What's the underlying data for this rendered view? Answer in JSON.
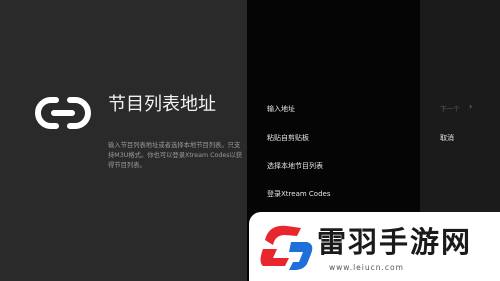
{
  "title": "节目列表地址",
  "description": "输入节目列表地址或者选择本地节目列表。只支持M3U格式。你也可以登录Xtream Codes以获得节目列表。",
  "menu": {
    "items": [
      {
        "label": "输入地址"
      },
      {
        "label": "粘贴自剪贴板"
      },
      {
        "label": "选择本地节目列表"
      },
      {
        "label": "登录Xtream Codes"
      }
    ]
  },
  "side": {
    "next_label": "下一个",
    "cancel_label": "取消"
  },
  "watermark": {
    "name": "雷羽手游网",
    "url": "www.leiucn.com"
  },
  "colors": {
    "left_panel": "#2a2a2a",
    "menu_panel": "#050505",
    "side_panel": "#1b1b1b",
    "logo_red": "#e8262d",
    "logo_blue": "#1e6fd9"
  }
}
